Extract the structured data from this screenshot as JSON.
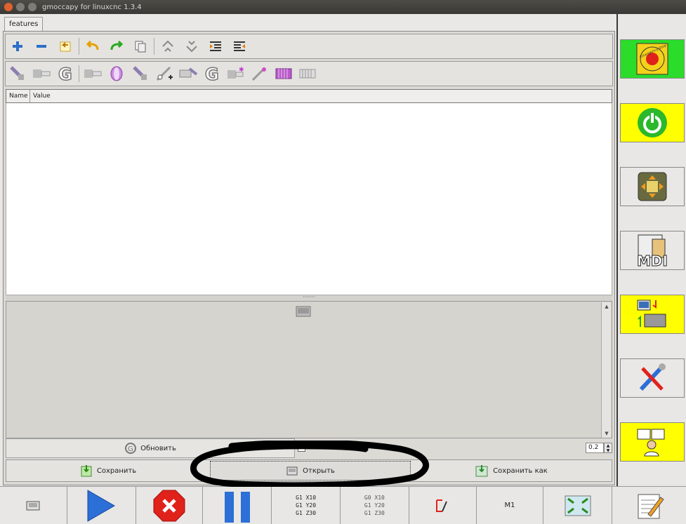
{
  "window": {
    "title": "gmoccapy for linuxcnc   1.3.4"
  },
  "tabs": [
    {
      "label": "features"
    }
  ],
  "toolbar1": [
    "add-icon",
    "remove-icon",
    "import-icon",
    "undo-icon",
    "redo-icon",
    "copy-icon",
    "move-up-icon",
    "move-down-icon",
    "indent-icon",
    "unindent-icon"
  ],
  "toolbar2": [
    "drill-icon",
    "pipe-icon",
    "g-code-icon",
    "tube-icon",
    "ring-icon",
    "drill-tool-icon",
    "point-tool-icon",
    "thread-tool-icon",
    "g-code-2-icon",
    "pipe-star-icon",
    "probe-tool-icon",
    "pink-thread-icon",
    "thread-icon"
  ],
  "table": {
    "columns": [
      "Name",
      "Value"
    ]
  },
  "buttons": {
    "refresh": "Обновить",
    "save": "Сохранить",
    "open": "Открыть",
    "save_as": "Сохранить как"
  },
  "spin": {
    "value": "0.2"
  },
  "bottom_gcode": {
    "box1": [
      "G1 X10",
      "G1 Y20",
      "G1 Z30"
    ],
    "box2": [
      "G0 X10",
      "G1 Y20",
      "G1 Z30"
    ],
    "m1": "M1"
  },
  "right_panel": {
    "estop_label": "Emergency-Stop",
    "mdi_label": "MDI"
  },
  "colors": {
    "estop_bg": "#2bdc2b",
    "power_bg": "#ffff00",
    "accent_red": "#e0221a",
    "play_blue": "#2c6fd6"
  }
}
